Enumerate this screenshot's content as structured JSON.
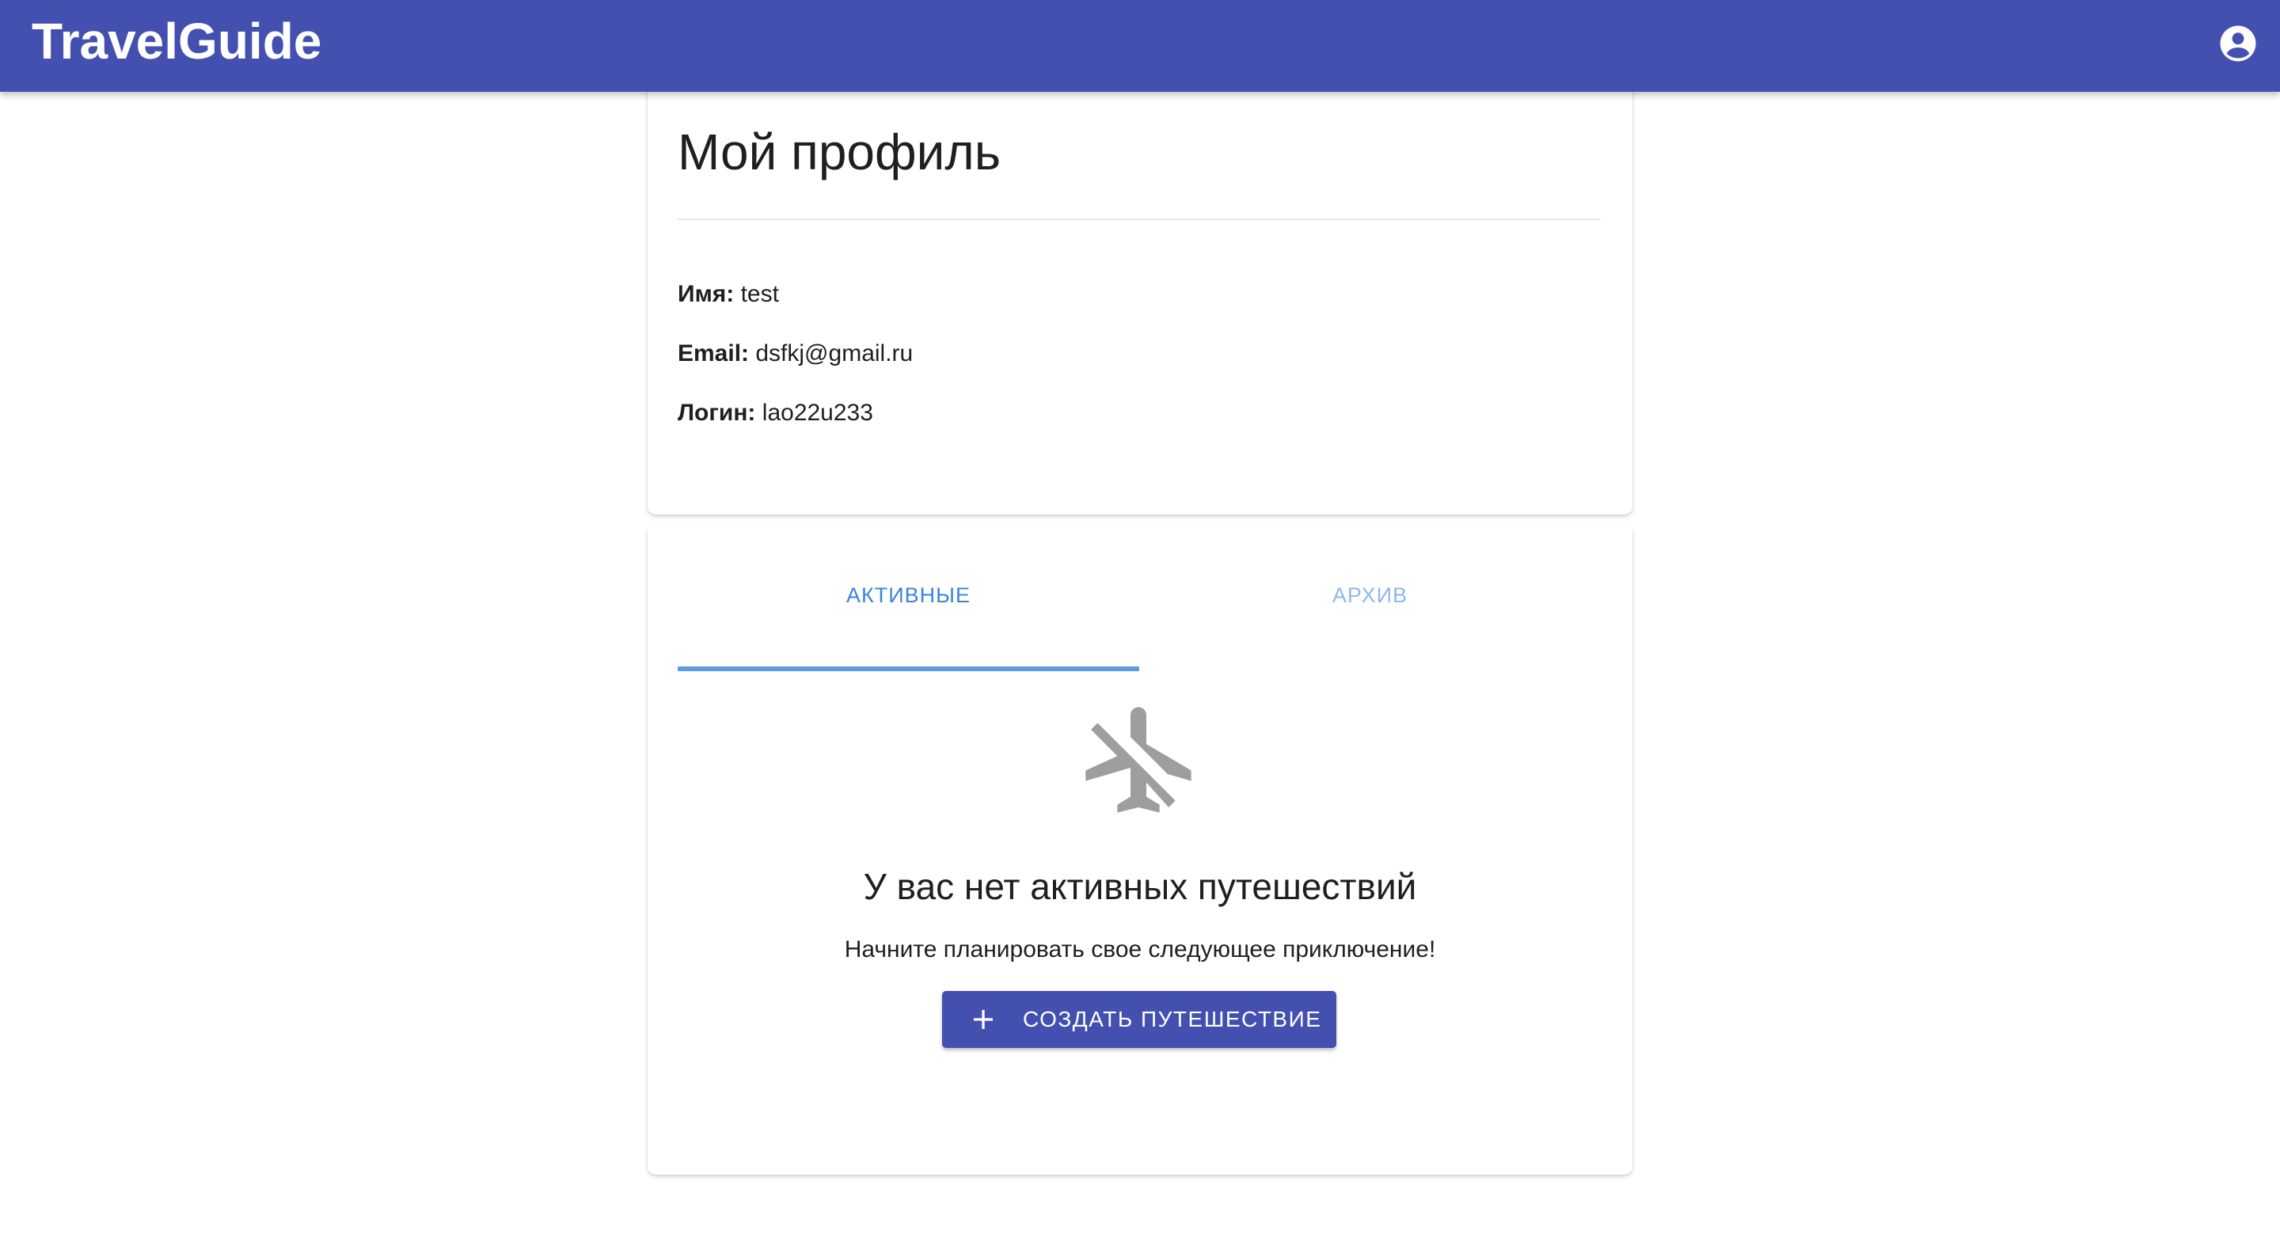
{
  "app": {
    "brand": "TravelGuide",
    "account_icon": "account-circle-icon"
  },
  "profile": {
    "title": "Мой профиль",
    "fields": [
      {
        "label": "Имя:",
        "value": "test"
      },
      {
        "label": "Email:",
        "value": "dsfkj@gmail.ru"
      },
      {
        "label": "Логин:",
        "value": "lao22u233"
      }
    ]
  },
  "trips": {
    "tabs": [
      {
        "label": "АКТИВНЫЕ",
        "selected": true
      },
      {
        "label": "АРХИВ",
        "selected": false
      }
    ],
    "empty_icon": "airplane-off-icon",
    "empty_title": "У вас нет активных путешествий",
    "empty_subtitle": "Начните планировать свое следующее приключение!",
    "create_button": {
      "icon": "plus-icon",
      "label": "СОЗДАТЬ ПУТЕШЕСТВИЕ"
    }
  },
  "colors": {
    "primary": "#4450b0",
    "tab_active": "#3a84dc",
    "tab_inactive": "#8fb8ea",
    "icon_muted": "#9e9e9e"
  }
}
